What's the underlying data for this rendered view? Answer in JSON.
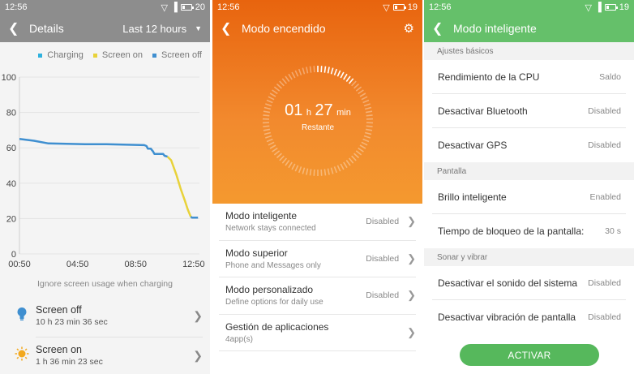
{
  "colors": {
    "charging": "#2fb1de",
    "screen_on": "#e8d23a",
    "screen_off": "#3f8fd0",
    "orange": "#e8640e",
    "green": "#65c06a"
  },
  "panel1": {
    "status": {
      "time": "12:56",
      "battery": "20"
    },
    "header": {
      "title": "Details",
      "range": "Last 12 hours"
    },
    "legend": [
      "Charging",
      "Screen on",
      "Screen off"
    ],
    "ignore_text": "Ignore screen usage when charging",
    "rows": [
      {
        "icon": "bulb-icon",
        "title": "Screen off",
        "detail": "10 h 23 min 36 sec"
      },
      {
        "icon": "sun-icon",
        "title": "Screen on",
        "detail": "1 h 36 min 23 sec"
      }
    ]
  },
  "chart_data": {
    "type": "line",
    "y_ticks": [
      "100",
      "80",
      "60",
      "40",
      "20",
      "0"
    ],
    "x_ticks": [
      "00:50",
      "04:50",
      "08:50",
      "12:50"
    ],
    "ylim": [
      0,
      100
    ],
    "xlim": [
      0,
      12.4
    ],
    "series": [
      {
        "name": "Screen off",
        "points": [
          [
            0,
            65
          ],
          [
            1.0,
            64
          ],
          [
            2.0,
            62.5
          ],
          [
            4.5,
            62
          ],
          [
            6.0,
            62
          ],
          [
            8.6,
            61.5
          ],
          [
            8.75,
            61
          ],
          [
            8.85,
            59.5
          ],
          [
            9.05,
            59.5
          ],
          [
            9.2,
            58
          ],
          [
            9.3,
            56.5
          ],
          [
            9.5,
            56.5
          ],
          [
            9.9,
            56.5
          ],
          [
            10.0,
            55.5
          ],
          [
            10.2,
            55
          ]
        ]
      },
      {
        "name": "Screen on",
        "points": [
          [
            10.2,
            55
          ],
          [
            10.45,
            53
          ],
          [
            10.8,
            45
          ],
          [
            11.1,
            37
          ],
          [
            11.4,
            30
          ],
          [
            11.6,
            25
          ],
          [
            11.8,
            21
          ]
        ]
      },
      {
        "name": "Screen off",
        "points": [
          [
            11.8,
            21
          ],
          [
            11.9,
            20.5
          ],
          [
            12.3,
            20.5
          ]
        ]
      }
    ]
  },
  "panel2": {
    "status": {
      "time": "12:56",
      "battery": "19"
    },
    "title": "Modo encendido",
    "dial": {
      "hours": "01",
      "h": "h",
      "minutes": "27",
      "min": "min",
      "label": "Restante",
      "fraction": 0.12
    },
    "items": [
      {
        "title": "Modo inteligente",
        "subtitle": "Network stays connected",
        "status": "Disabled"
      },
      {
        "title": "Modo superior",
        "subtitle": "Phone and Messages only",
        "status": "Disabled"
      },
      {
        "title": "Modo personalizado",
        "subtitle": "Define options for daily use",
        "status": "Disabled"
      },
      {
        "title": "Gestión de aplicaciones",
        "subtitle": "4app(s)",
        "status": ""
      }
    ]
  },
  "panel3": {
    "status": {
      "time": "12:56",
      "battery": "19"
    },
    "title": "Modo inteligente",
    "sections": [
      {
        "header": "Ajustes básicos",
        "rows": [
          {
            "label": "Rendimiento de la CPU",
            "value": "Saldo"
          },
          {
            "label": "Desactivar Bluetooth",
            "value": "Disabled"
          },
          {
            "label": "Desactivar GPS",
            "value": "Disabled"
          }
        ]
      },
      {
        "header": "Pantalla",
        "rows": [
          {
            "label": "Brillo inteligente",
            "value": "Enabled"
          },
          {
            "label": "Tiempo de bloqueo de la pantalla:",
            "value": "30 s"
          }
        ]
      },
      {
        "header": "Sonar y vibrar",
        "rows": [
          {
            "label": "Desactivar el sonido del sistema",
            "value": "Disabled"
          },
          {
            "label": "Desactivar vibración de pantalla",
            "value": "Disabled"
          }
        ]
      }
    ],
    "button": "ACTIVAR"
  }
}
